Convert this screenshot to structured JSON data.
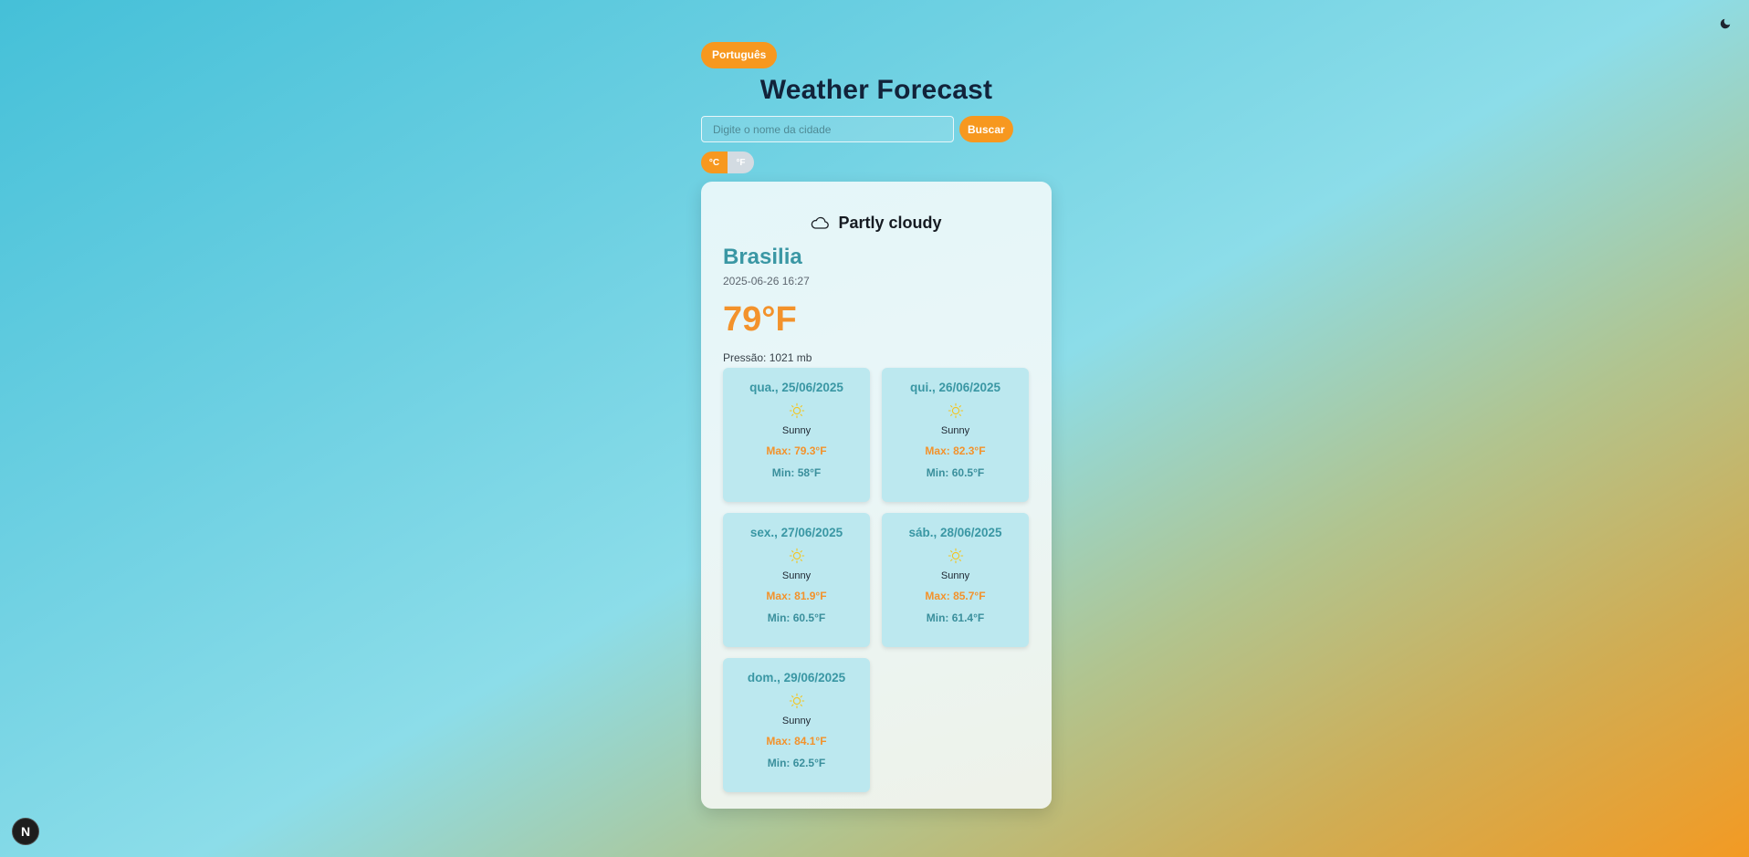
{
  "language_button": "Português",
  "title": "Weather Forecast",
  "search": {
    "placeholder": "Digite o nome da cidade",
    "value": "",
    "button": "Buscar"
  },
  "units": {
    "celsius": "°C",
    "fahrenheit": "°F",
    "selected": "°C"
  },
  "current": {
    "condition": "Partly cloudy",
    "condition_icon": "cloud-icon",
    "city": "Brasilia",
    "datetime": "2025-06-26 16:27",
    "temperature": "79°F",
    "pressure": "Pressão: 1021 mb"
  },
  "forecast": [
    {
      "date": "qua., 25/06/2025",
      "icon": "sun-icon",
      "desc": "Sunny",
      "max": "Max: 79.3°F",
      "min": "Min: 58°F"
    },
    {
      "date": "qui., 26/06/2025",
      "icon": "sun-icon",
      "desc": "Sunny",
      "max": "Max: 82.3°F",
      "min": "Min: 60.5°F"
    },
    {
      "date": "sex., 27/06/2025",
      "icon": "sun-icon",
      "desc": "Sunny",
      "max": "Max: 81.9°F",
      "min": "Min: 60.5°F"
    },
    {
      "date": "sáb., 28/06/2025",
      "icon": "sun-icon",
      "desc": "Sunny",
      "max": "Max: 85.7°F",
      "min": "Min: 61.4°F"
    },
    {
      "date": "dom., 29/06/2025",
      "icon": "sun-icon",
      "desc": "Sunny",
      "max": "Max: 84.1°F",
      "min": "Min: 62.5°F"
    }
  ],
  "colors": {
    "accent": "#f7981f",
    "city": "#3a97a4",
    "temp": "#f3922b",
    "forecast_card": "#bce8ef"
  },
  "dev_badge": "N",
  "theme_toggle_icon": "moon-icon"
}
